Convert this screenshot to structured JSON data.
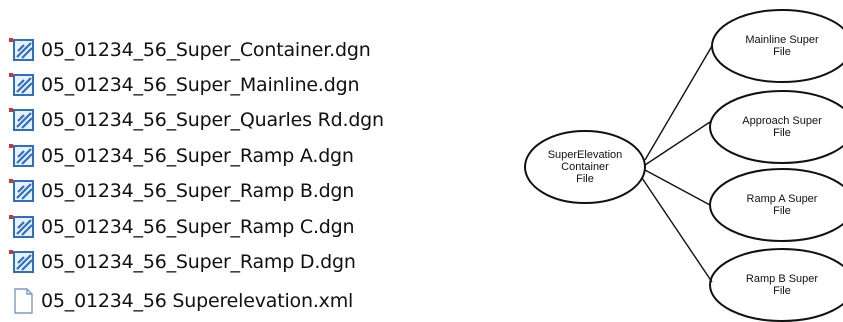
{
  "files": [
    {
      "name": "05_01234_56_Super_Container.dgn",
      "icon": "microstation-dgn-icon"
    },
    {
      "name": "05_01234_56_Super_Mainline.dgn",
      "icon": "microstation-dgn-icon"
    },
    {
      "name": "05_01234_56_Super_Quarles Rd.dgn",
      "icon": "microstation-dgn-icon"
    },
    {
      "name": "05_01234_56_Super_Ramp A.dgn",
      "icon": "microstation-dgn-icon"
    },
    {
      "name": "05_01234_56_Super_Ramp B.dgn",
      "icon": "microstation-dgn-icon"
    },
    {
      "name": "05_01234_56_Super_Ramp C.dgn",
      "icon": "microstation-dgn-icon"
    },
    {
      "name": "05_01234_56_Super_Ramp D.dgn",
      "icon": "microstation-dgn-icon"
    },
    {
      "name": "05_01234_56 Superelevation.xml",
      "icon": "blank-document-icon"
    }
  ],
  "diagram": {
    "root": {
      "lines": [
        "SuperElevation",
        "Container",
        "File"
      ]
    },
    "children": [
      {
        "lines": [
          "Mainline Super",
          "File"
        ]
      },
      {
        "lines": [
          "Approach Super",
          "File"
        ]
      },
      {
        "lines": [
          "Ramp A Super",
          "File"
        ]
      },
      {
        "lines": [
          "Ramp B Super",
          "File"
        ]
      }
    ]
  },
  "colors": {
    "icon_blue": "#2f6fc0",
    "icon_accent": "#c8382f",
    "diagram_stroke": "#111111"
  }
}
